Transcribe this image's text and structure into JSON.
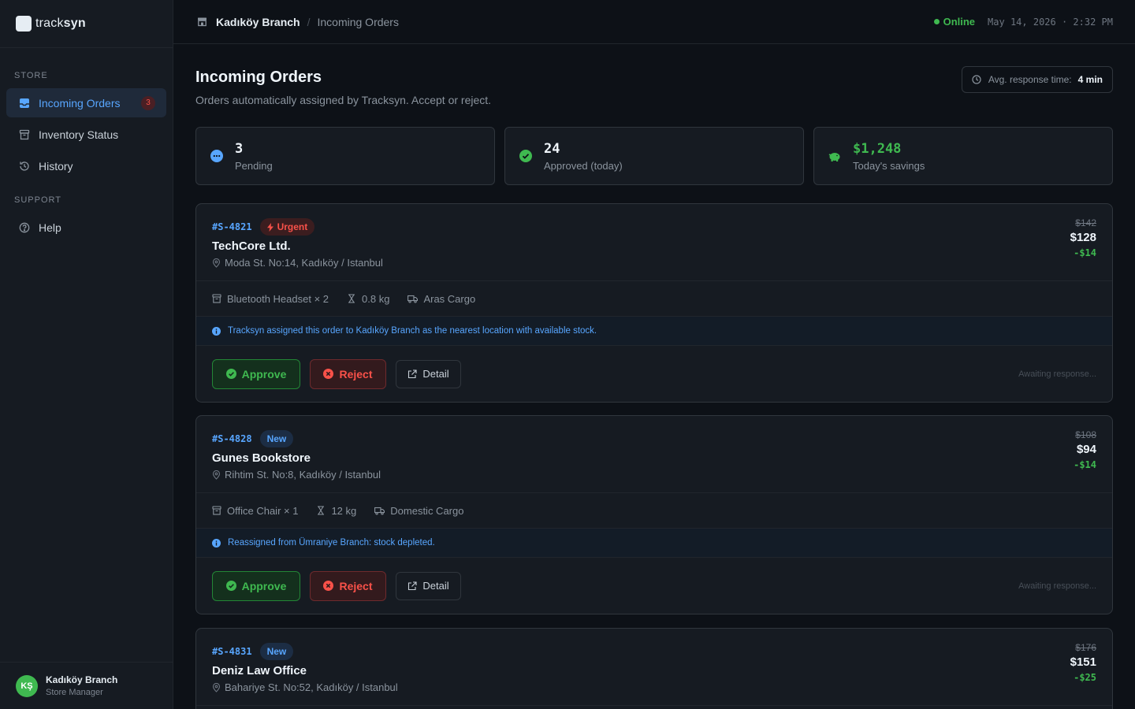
{
  "brand": {
    "name_light": "track",
    "name_bold": "syn"
  },
  "sidebar": {
    "sections": {
      "store": "STORE",
      "support": "SUPPORT"
    },
    "items": [
      {
        "label": "Incoming Orders",
        "badge": "3",
        "icon": "inbox-icon",
        "active": true
      },
      {
        "label": "Inventory Status",
        "icon": "box-icon"
      },
      {
        "label": "History",
        "icon": "history-icon"
      },
      {
        "label": "Help",
        "icon": "help-icon"
      }
    ],
    "user": {
      "initials": "KŞ",
      "name": "Kadıköy Branch",
      "role": "Store Manager"
    }
  },
  "header": {
    "branch": "Kadıköy Branch",
    "separator": "/",
    "page": "Incoming Orders",
    "status": "Online",
    "datetime": "May 14, 2026 · 2:32 PM"
  },
  "page": {
    "title": "Incoming Orders",
    "subtitle": "Orders automatically assigned by Tracksyn. Accept or reject.",
    "response_label": "Avg. response time:",
    "response_value": "4 min"
  },
  "stats": [
    {
      "value": "3",
      "label": "Pending",
      "icon": "clock-dots-icon",
      "color": "#58a6ff"
    },
    {
      "value": "24",
      "label": "Approved (today)",
      "icon": "check-circle-icon",
      "color": "#3fb950"
    },
    {
      "value": "$1,248",
      "label": "Today's savings",
      "icon": "piggy-bank-icon",
      "color": "#3fb950"
    }
  ],
  "actions": {
    "approve": "Approve",
    "reject": "Reject",
    "detail": "Detail",
    "awaiting": "Awaiting response..."
  },
  "orders": [
    {
      "id": "#S-4821",
      "tag": "Urgent",
      "company": "TechCore Ltd.",
      "address": "Moda St. No:14, Kadıköy / Istanbul",
      "old_price": "$142",
      "new_price": "$128",
      "saving": "-$14",
      "item": "Bluetooth Headset × 2",
      "weight": "0.8 kg",
      "carrier": "Aras Cargo",
      "note": "Tracksyn assigned this order to Kadıköy Branch as the nearest location with available stock."
    },
    {
      "id": "#S-4828",
      "tag": "New",
      "company": "Gunes Bookstore",
      "address": "Rihtim St. No:8, Kadıköy / Istanbul",
      "old_price": "$108",
      "new_price": "$94",
      "saving": "-$14",
      "item": "Office Chair × 1",
      "weight": "12 kg",
      "carrier": "Domestic Cargo",
      "note": "Reassigned from Ümraniye Branch: stock depleted."
    },
    {
      "id": "#S-4831",
      "tag": "New",
      "company": "Deniz Law Office",
      "address": "Bahariye St. No:52, Kadıköy / Istanbul",
      "old_price": "$176",
      "new_price": "$151",
      "saving": "-$25"
    }
  ]
}
